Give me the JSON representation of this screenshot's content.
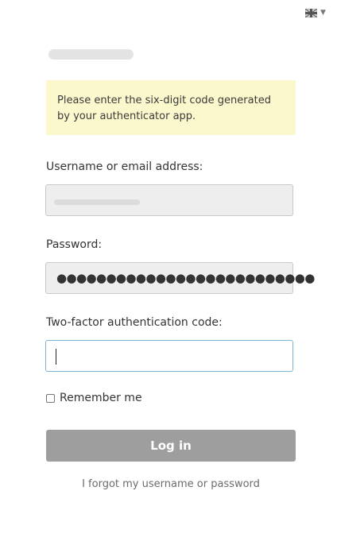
{
  "language": {
    "icon": "uk-flag-icon",
    "dropdown_icon": "caret-down-icon",
    "caret_glyph": "▼"
  },
  "notice": {
    "text": "Please enter the six-digit code generated by your authenticator app."
  },
  "form": {
    "username_label": "Username or email address:",
    "password_label": "Password:",
    "password_value": "●●●●●●●●●●●●●●●●●●●●●●●●●●",
    "twofactor_label": "Two-factor authentication code:",
    "twofactor_value": "",
    "remember_label": "Remember me",
    "remember_checked": false,
    "login_label": "Log in",
    "forgot_label": "I forgot my username or password"
  },
  "colors": {
    "notice_bg": "#fcf8cd",
    "login_button_bg": "#9e9e9e",
    "focused_border": "#7fb3d5"
  }
}
